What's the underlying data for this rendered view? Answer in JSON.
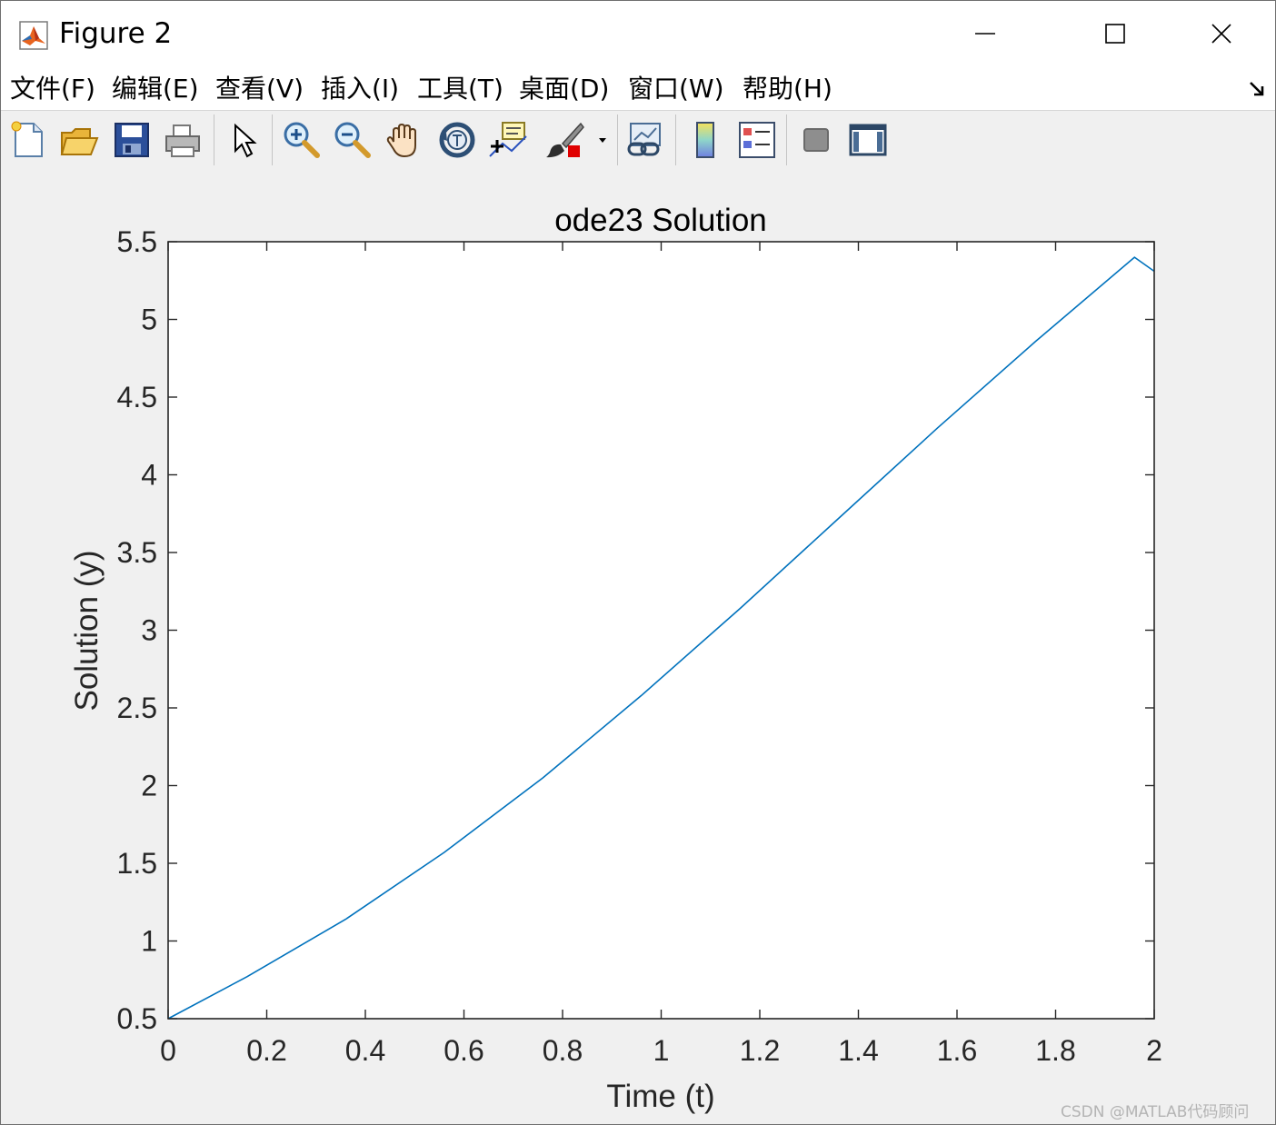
{
  "window": {
    "title": "Figure 2",
    "icon": "matlab-logo-icon"
  },
  "menu": {
    "items": [
      {
        "label": "文件(F)"
      },
      {
        "label": "编辑(E)"
      },
      {
        "label": "查看(V)"
      },
      {
        "label": "插入(I)"
      },
      {
        "label": "工具(T)"
      },
      {
        "label": "桌面(D)"
      },
      {
        "label": "窗口(W)"
      },
      {
        "label": "帮助(H)"
      }
    ],
    "dock_icon": "dock-arrow-icon"
  },
  "toolbar": {
    "icons": [
      "new-figure-icon",
      "open-file-icon",
      "save-icon",
      "print-icon",
      "edit-plot-arrow-icon",
      "zoom-in-icon",
      "zoom-out-icon",
      "pan-hand-icon",
      "rotate-3d-icon",
      "data-cursor-icon",
      "brush-icon",
      "dropdown-arrow-icon",
      "link-plot-icon",
      "colorbar-icon",
      "legend-icon",
      "hide-plot-tools-icon",
      "show-plot-tools-icon"
    ]
  },
  "chart_data": {
    "type": "line",
    "title": "ode23 Solution",
    "xlabel": "Time (t)",
    "ylabel": "Solution (y)",
    "xlim": [
      0,
      2
    ],
    "ylim": [
      0.5,
      5.5
    ],
    "xticks": [
      0,
      0.2,
      0.4,
      0.6,
      0.8,
      1,
      1.2,
      1.4,
      1.6,
      1.8,
      2
    ],
    "xtick_labels": [
      "0",
      "0.2",
      "0.4",
      "0.6",
      "0.8",
      "1",
      "1.2",
      "1.4",
      "1.6",
      "1.8",
      "2"
    ],
    "yticks": [
      0.5,
      1,
      1.5,
      2,
      2.5,
      3,
      3.5,
      4,
      4.5,
      5,
      5.5
    ],
    "ytick_labels": [
      "0.5",
      "1",
      "1.5",
      "2",
      "2.5",
      "3",
      "3.5",
      "4",
      "4.5",
      "5",
      "5.5"
    ],
    "grid": false,
    "series": [
      {
        "color": "#0072bd",
        "x": [
          0,
          0.16,
          0.36,
          0.56,
          0.76,
          0.96,
          1.16,
          1.36,
          1.56,
          1.76,
          1.96,
          2.0
        ],
        "y": [
          0.5,
          0.77,
          1.14,
          1.57,
          2.05,
          2.58,
          3.14,
          3.72,
          4.3,
          4.86,
          5.4,
          5.31
        ]
      }
    ]
  },
  "watermark": "CSDN @MATLAB代码顾问"
}
